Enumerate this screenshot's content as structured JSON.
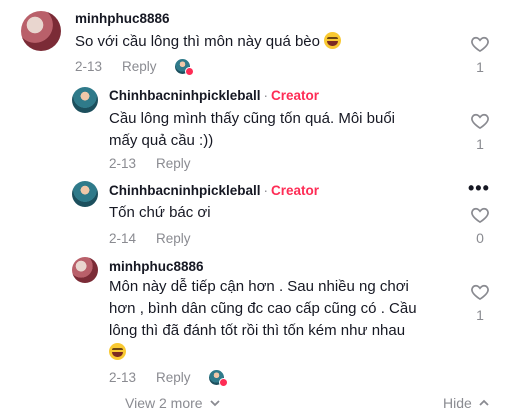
{
  "comments": [
    {
      "username": "minhphuc8886",
      "text": "So với cầu lông thì môn này quá bèo",
      "date": "2-13",
      "reply_label": "Reply",
      "likes": "1"
    }
  ],
  "replies": [
    {
      "username": "Chinhbacninhpickleball",
      "creator_label": "Creator",
      "text_line1": "Cầu lông mình thấy cũng tốn quá. Môi buổi",
      "text_line2": "mấy quả cầu :))",
      "date": "2-13",
      "reply_label": "Reply",
      "likes": "1"
    },
    {
      "username": "Chinhbacninhpickleball",
      "creator_label": "Creator",
      "text": "Tốn chứ bác ơi",
      "date": "2-14",
      "reply_label": "Reply",
      "likes": "0"
    },
    {
      "username": "minhphuc8886",
      "text_line1": "Môn này dễ tiếp cận hơn . Sau nhiều ng chơi",
      "text_line2": "hơn , bình dân cũng đc cao cấp cũng có . Cầu",
      "text_line3": "lông thì đã đánh tốt rồi thì tốn kém như nhau",
      "date": "2-13",
      "reply_label": "Reply",
      "likes": "1"
    }
  ],
  "footer": {
    "view_more": "View 2 more",
    "hide": "Hide"
  },
  "icons": {
    "like": "heart-outline-icon",
    "emoji": "grinning-squinting-face-emoji",
    "more": "more-dots-icon",
    "chevron": "chevron-down-icon"
  },
  "colors": {
    "creator": "#fe2c55",
    "muted": "#8a8b91",
    "text": "#161823"
  }
}
